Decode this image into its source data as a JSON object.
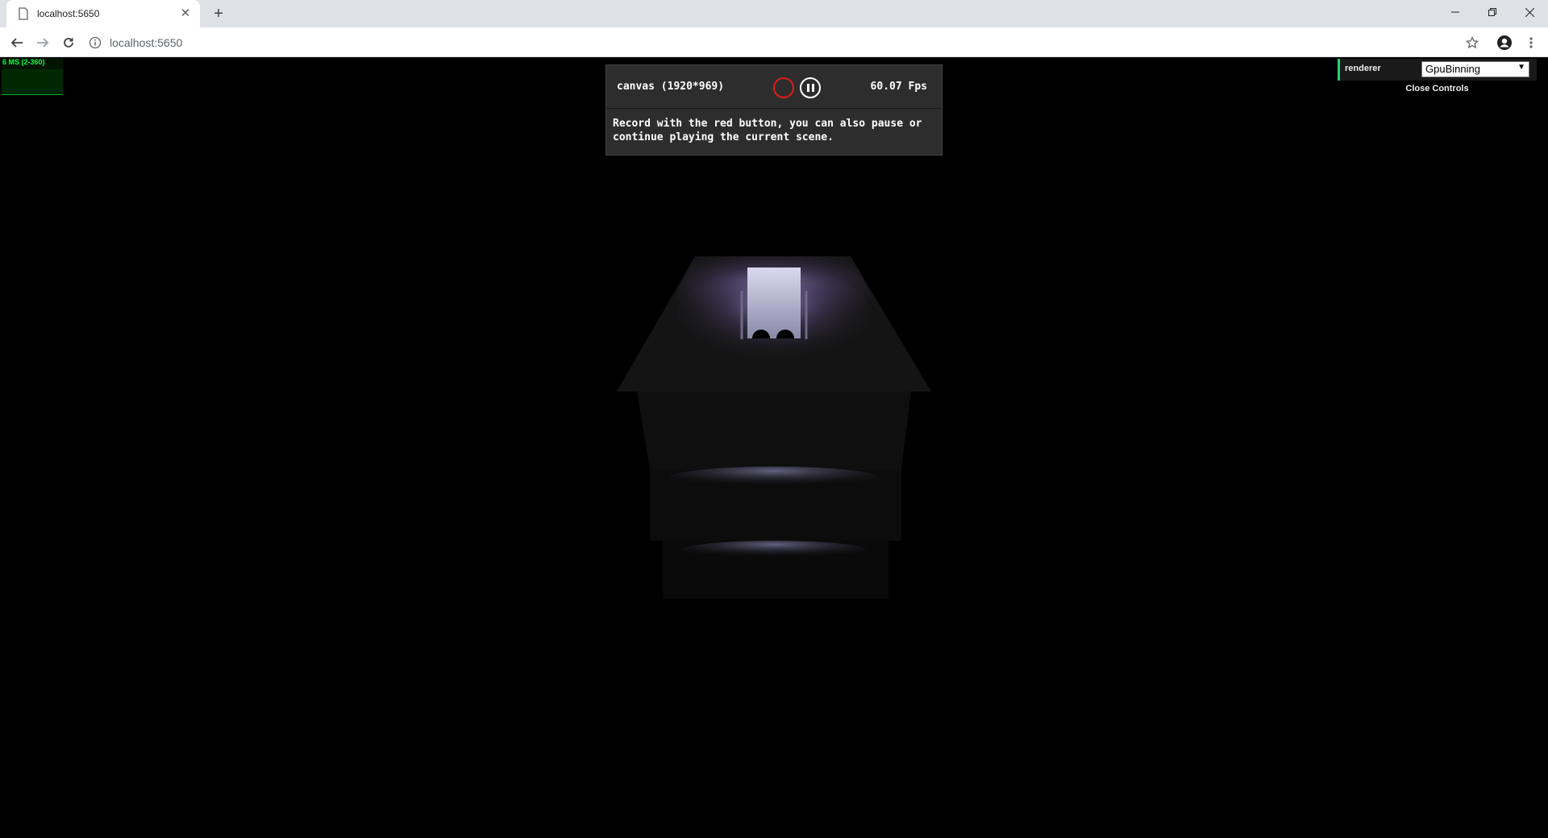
{
  "browser": {
    "tab_title": "localhost:5650",
    "url": "localhost:5650"
  },
  "stats": {
    "label": "6 MS (2-360)"
  },
  "recorder": {
    "canvas_label": "canvas (1920*969)",
    "fps": "60.07 Fps",
    "message": "Record with the red button, you can also pause or continue playing the current scene."
  },
  "controls": {
    "renderer_label": "renderer",
    "renderer_value": "GpuBinning",
    "close_label": "Close Controls"
  },
  "colors": {
    "record": "#e01b1b",
    "stats_green": "#00ff40",
    "panel_bg": "#2d2d2d"
  }
}
